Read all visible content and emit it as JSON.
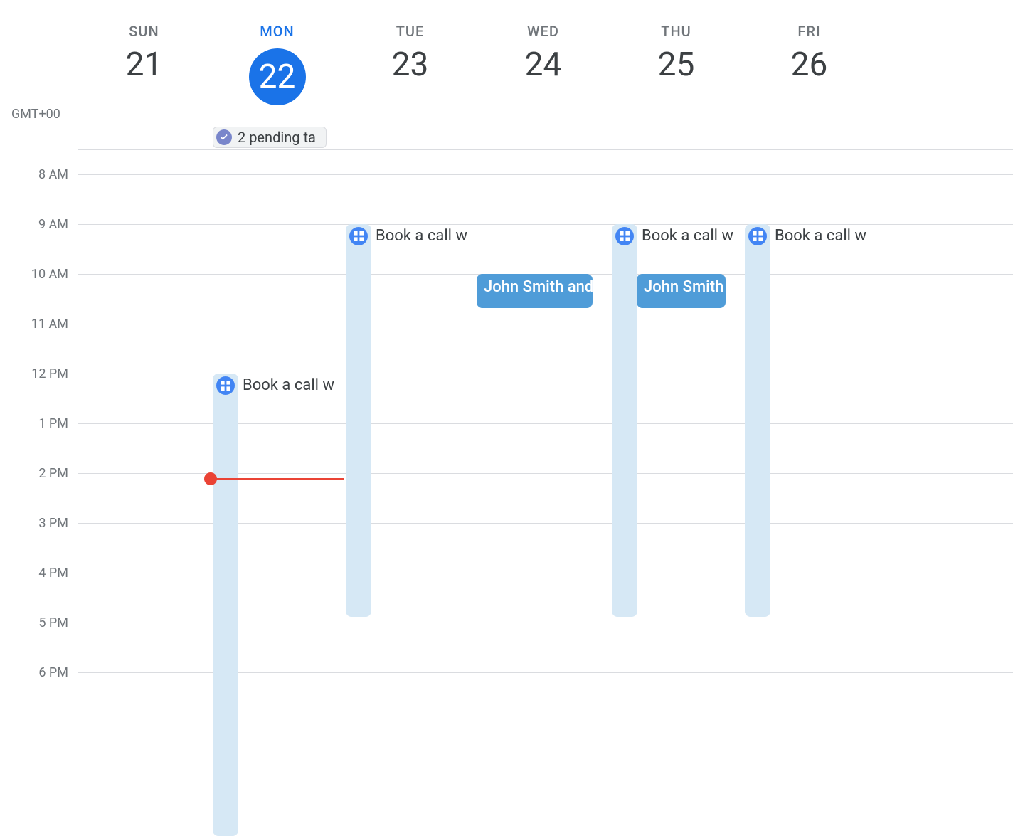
{
  "timezone_label": "GMT+00",
  "days": [
    {
      "label": "SUN",
      "num": "21",
      "today": false
    },
    {
      "label": "MON",
      "num": "22",
      "today": true
    },
    {
      "label": "TUE",
      "num": "23",
      "today": false
    },
    {
      "label": "WED",
      "num": "24",
      "today": false
    },
    {
      "label": "THU",
      "num": "25",
      "today": false
    },
    {
      "label": "FRI",
      "num": "26",
      "today": false
    }
  ],
  "hours": [
    "8 AM",
    "9 AM",
    "10 AM",
    "11 AM",
    "12 PM",
    "1 PM",
    "2 PM",
    "3 PM",
    "4 PM",
    "5 PM",
    "6 PM"
  ],
  "pending_tasks_label": "2 pending ta",
  "slot_events": {
    "mon": "Book a call w",
    "tue": "Book a call w",
    "thu": "Book a call w",
    "fri": "Book a call w"
  },
  "events": {
    "wed_john": "John Smith and",
    "thu_john": "John Smith a"
  }
}
